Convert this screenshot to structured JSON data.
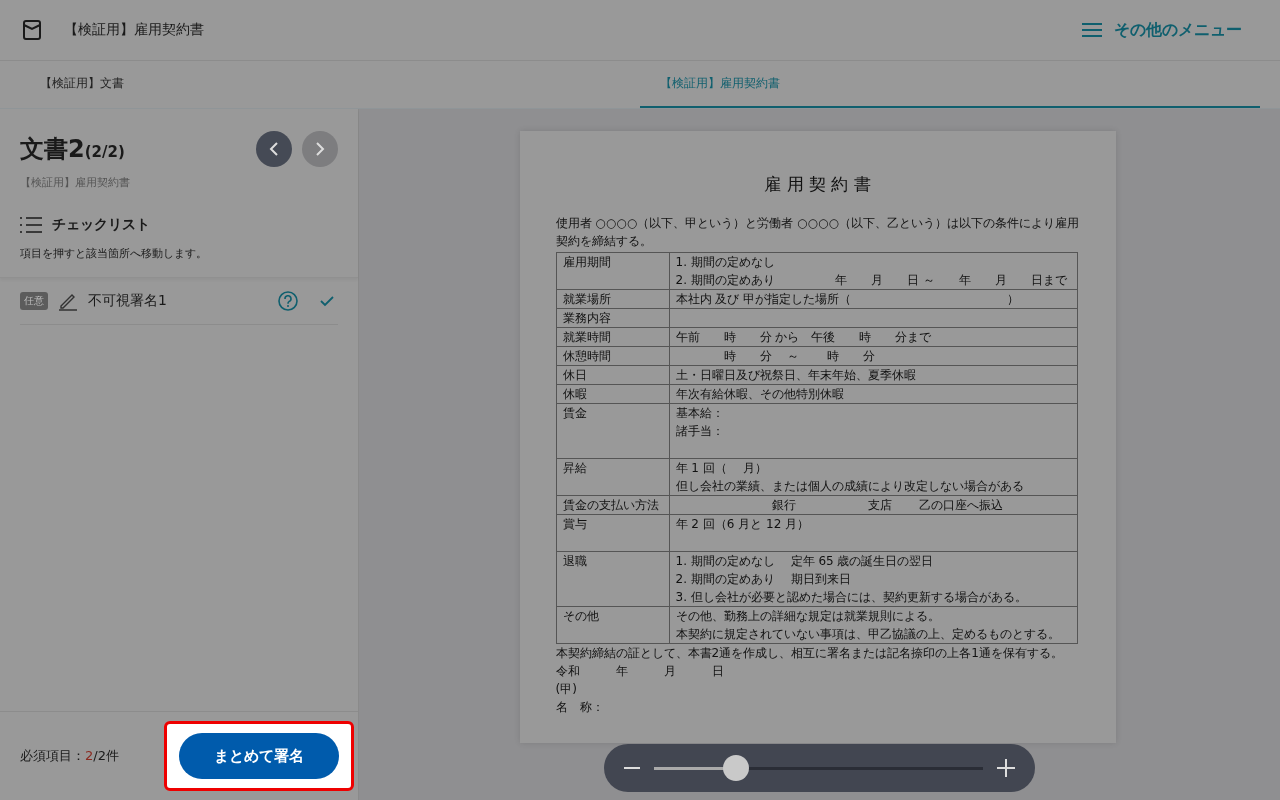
{
  "header": {
    "title": "【検証用】雇用契約書",
    "menu_label": "その他のメニュー"
  },
  "tabs": [
    {
      "label": "【検証用】文書",
      "selected": false
    },
    {
      "label": "【検証用】雇用契約書",
      "selected": true
    }
  ],
  "sidebar": {
    "doc_title": "文書2",
    "doc_count": "(2/2)",
    "prev": {
      "disabled": false
    },
    "next": {
      "disabled": true
    },
    "doc_name": "【検証用】雇用契約書",
    "checklist_title": "チェックリスト",
    "checklist_hint": "項目を押すと該当箇所へ移動します。",
    "items": [
      {
        "badge": "任意",
        "label": "不可視署名1",
        "checked": true
      }
    ],
    "required_label": "必須項目：",
    "required_done": "2",
    "required_total": "/2件",
    "sign_button": "まとめて署名"
  },
  "document": {
    "title": "雇 用 契 約 書",
    "intro": "使用者 ○○○○（以下、甲という）と労働者 ○○○○（以下、乙という）は以下の条件により雇用契約を締結する。",
    "rows": [
      {
        "label": "雇用期間",
        "lines": [
          "1. 期間の定めなし",
          "2. 期間の定めあり　　　　　年　　月　　日 ～　　年　　月　　日まで"
        ]
      },
      {
        "label": "就業場所",
        "lines": [
          "本社内 及び 甲が指定した場所（　　　　　　　　　　　　　）"
        ]
      },
      {
        "label": "業務内容",
        "lines": []
      },
      {
        "label": "就業時間",
        "lines": [
          "午前　　時　　分 から　午後　　時　　分まで"
        ]
      },
      {
        "label": "休憩時間",
        "lines": [
          "　　　　時　　分　 ～　　 時　　分"
        ]
      },
      {
        "label": "休日",
        "lines": [
          "土・日曜日及び祝祭日、年末年始、夏季休暇"
        ]
      },
      {
        "label": "休暇",
        "lines": [
          "年次有給休暇、その他特別休暇"
        ]
      },
      {
        "label": "賃金",
        "lines": [
          "基本給：",
          "諸手当："
        ],
        "tall": true
      },
      {
        "label": "昇給",
        "lines": [
          "年 1 回（　 月）",
          "但し会社の業績、または個人の成績により改定しない場合がある"
        ]
      },
      {
        "label": "賃金の支払い方法",
        "lines": [
          "　　　　　　　　銀行　　　　　　支店　　 乙の口座へ振込"
        ]
      },
      {
        "label": "賞与",
        "lines": [
          "年 2 回（6 月と 12 月）"
        ],
        "tall": true
      },
      {
        "label": "退職",
        "lines": [
          "1. 期間の定めなし　 定年 65 歳の誕生日の翌日",
          "2. 期間の定めあり　 期日到来日",
          "3. 但し会社が必要と認めた場合には、契約更新する場合がある。"
        ]
      },
      {
        "label": "その他",
        "lines": [
          "その他、勤務上の詳細な規定は就業規則による。",
          "本契約に規定されていない事項は、甲乙協議の上、定めるものとする。"
        ]
      }
    ],
    "closing": "本契約締結の証として、本書2通を作成し、相互に署名または記名捺印の上各1通を保有する。",
    "date": "令和　　　年　　　月　　　日",
    "party": "(甲)",
    "name_label": "名　称："
  },
  "zoom": {
    "level": 0.25
  }
}
